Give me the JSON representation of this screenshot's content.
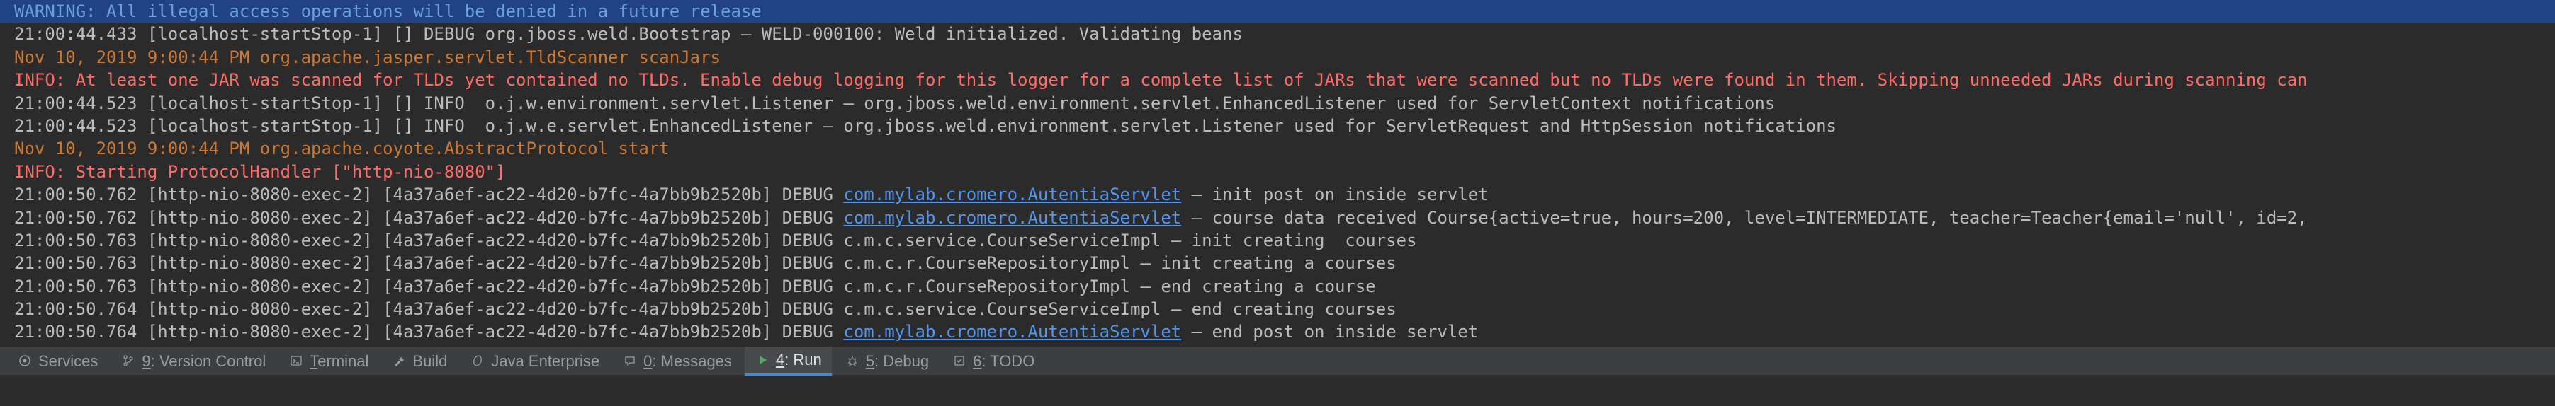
{
  "lines": [
    {
      "cls": "highlighted warn-blue",
      "text": "WARNING: All illegal access operations will be denied in a future release"
    },
    {
      "cls": "gray",
      "segs": [
        {
          "t": "21:00:44.433 [localhost-startStop-1] [] DEBUG org.jboss.weld.Bootstrap – WELD-000100: Weld initialized. Validating beans"
        }
      ]
    },
    {
      "cls": "orange",
      "text": "Nov 10, 2019 9:00:44 PM org.apache.jasper.servlet.TldScanner scanJars"
    },
    {
      "cls": "red",
      "text": "INFO: At least one JAR was scanned for TLDs yet contained no TLDs. Enable debug logging for this logger for a complete list of JARs that were scanned but no TLDs were found in them. Skipping unneeded JARs during scanning can"
    },
    {
      "cls": "gray",
      "text": "21:00:44.523 [localhost-startStop-1] [] INFO  o.j.w.environment.servlet.Listener – org.jboss.weld.environment.servlet.EnhancedListener used for ServletContext notifications"
    },
    {
      "cls": "gray",
      "text": "21:00:44.523 [localhost-startStop-1] [] INFO  o.j.w.e.servlet.EnhancedListener – org.jboss.weld.environment.servlet.Listener used for ServletRequest and HttpSession notifications"
    },
    {
      "cls": "orange",
      "text": "Nov 10, 2019 9:00:44 PM org.apache.coyote.AbstractProtocol start"
    },
    {
      "cls": "red",
      "text": "INFO: Starting ProtocolHandler [\"http-nio-8080\"]"
    },
    {
      "cls": "gray",
      "segs": [
        {
          "t": "21:00:50.762 [http-nio-8080-exec-2] [4a37a6ef-ac22-4d20-b7fc-4a7bb9b2520b] DEBUG "
        },
        {
          "t": "com.mylab.cromero.AutentiaServlet",
          "link": true
        },
        {
          "t": " – init post on inside servlet"
        }
      ]
    },
    {
      "cls": "gray",
      "segs": [
        {
          "t": "21:00:50.762 [http-nio-8080-exec-2] [4a37a6ef-ac22-4d20-b7fc-4a7bb9b2520b] DEBUG "
        },
        {
          "t": "com.mylab.cromero.AutentiaServlet",
          "link": true
        },
        {
          "t": " – course data received Course{active=true, hours=200, level=INTERMEDIATE, teacher=Teacher{email='null', id=2,"
        }
      ]
    },
    {
      "cls": "gray",
      "text": "21:00:50.763 [http-nio-8080-exec-2] [4a37a6ef-ac22-4d20-b7fc-4a7bb9b2520b] DEBUG c.m.c.service.CourseServiceImpl – init creating  courses"
    },
    {
      "cls": "gray",
      "text": "21:00:50.763 [http-nio-8080-exec-2] [4a37a6ef-ac22-4d20-b7fc-4a7bb9b2520b] DEBUG c.m.c.r.CourseRepositoryImpl – init creating a courses"
    },
    {
      "cls": "gray",
      "text": "21:00:50.763 [http-nio-8080-exec-2] [4a37a6ef-ac22-4d20-b7fc-4a7bb9b2520b] DEBUG c.m.c.r.CourseRepositoryImpl – end creating a course"
    },
    {
      "cls": "gray",
      "text": "21:00:50.764 [http-nio-8080-exec-2] [4a37a6ef-ac22-4d20-b7fc-4a7bb9b2520b] DEBUG c.m.c.service.CourseServiceImpl – end creating courses"
    },
    {
      "cls": "gray",
      "segs": [
        {
          "t": "21:00:50.764 [http-nio-8080-exec-2] [4a37a6ef-ac22-4d20-b7fc-4a7bb9b2520b] DEBUG "
        },
        {
          "t": "com.mylab.cromero.AutentiaServlet",
          "link": true
        },
        {
          "t": " – end post on inside servlet"
        }
      ]
    }
  ],
  "tabs": [
    {
      "id": "services",
      "icon": "services",
      "label": "Services",
      "ul": ""
    },
    {
      "id": "vcs",
      "icon": "branch",
      "label": "9: Version Control",
      "ul": "9"
    },
    {
      "id": "terminal",
      "icon": "terminal",
      "label": "Terminal",
      "ul": "T"
    },
    {
      "id": "build",
      "icon": "hammer",
      "label": "Build",
      "ul": ""
    },
    {
      "id": "javaee",
      "icon": "bean",
      "label": "Java Enterprise",
      "ul": ""
    },
    {
      "id": "messages",
      "icon": "messages",
      "label": "0: Messages",
      "ul": "0"
    },
    {
      "id": "run",
      "icon": "run",
      "label": "4: Run",
      "ul": "4",
      "active": true
    },
    {
      "id": "debug",
      "icon": "debug",
      "label": "5: Debug",
      "ul": "5"
    },
    {
      "id": "todo",
      "icon": "todo",
      "label": "6: TODO",
      "ul": "6"
    }
  ]
}
